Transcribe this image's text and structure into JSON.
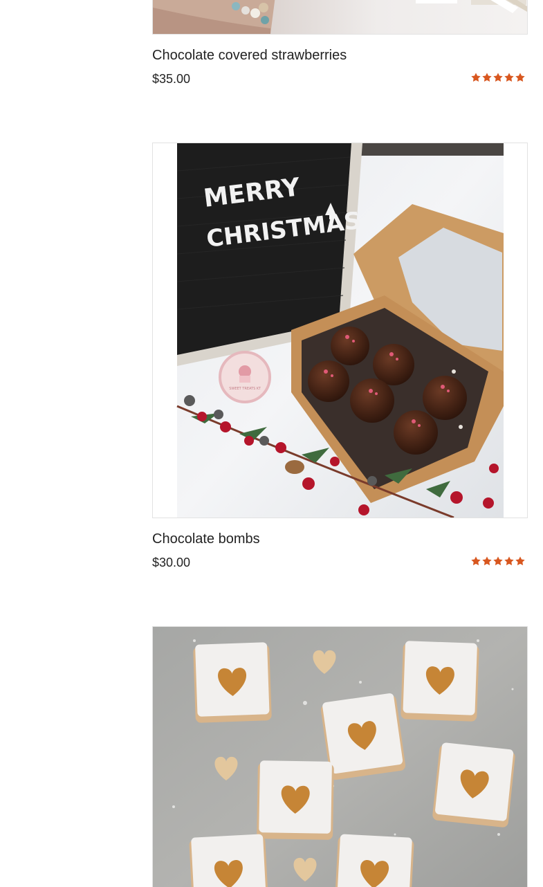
{
  "products": [
    {
      "title": "Chocolate covered strawberries",
      "price": "$35.00",
      "rating": 5,
      "rating_max": 5,
      "image_label": "strawberries-photo"
    },
    {
      "title": "Chocolate bombs",
      "price": "$30.00",
      "rating": 5,
      "rating_max": 5,
      "image_label": "chocolate-bombs-photo",
      "image_text": [
        "MERRY",
        "CHRISTMAS"
      ],
      "logo_text": "SWEET TREATS KT"
    },
    {
      "image_label": "linzer-cookies-photo"
    }
  ],
  "colors": {
    "star": "#d8571f",
    "border": "#e2e2e2",
    "text": "#222222"
  }
}
